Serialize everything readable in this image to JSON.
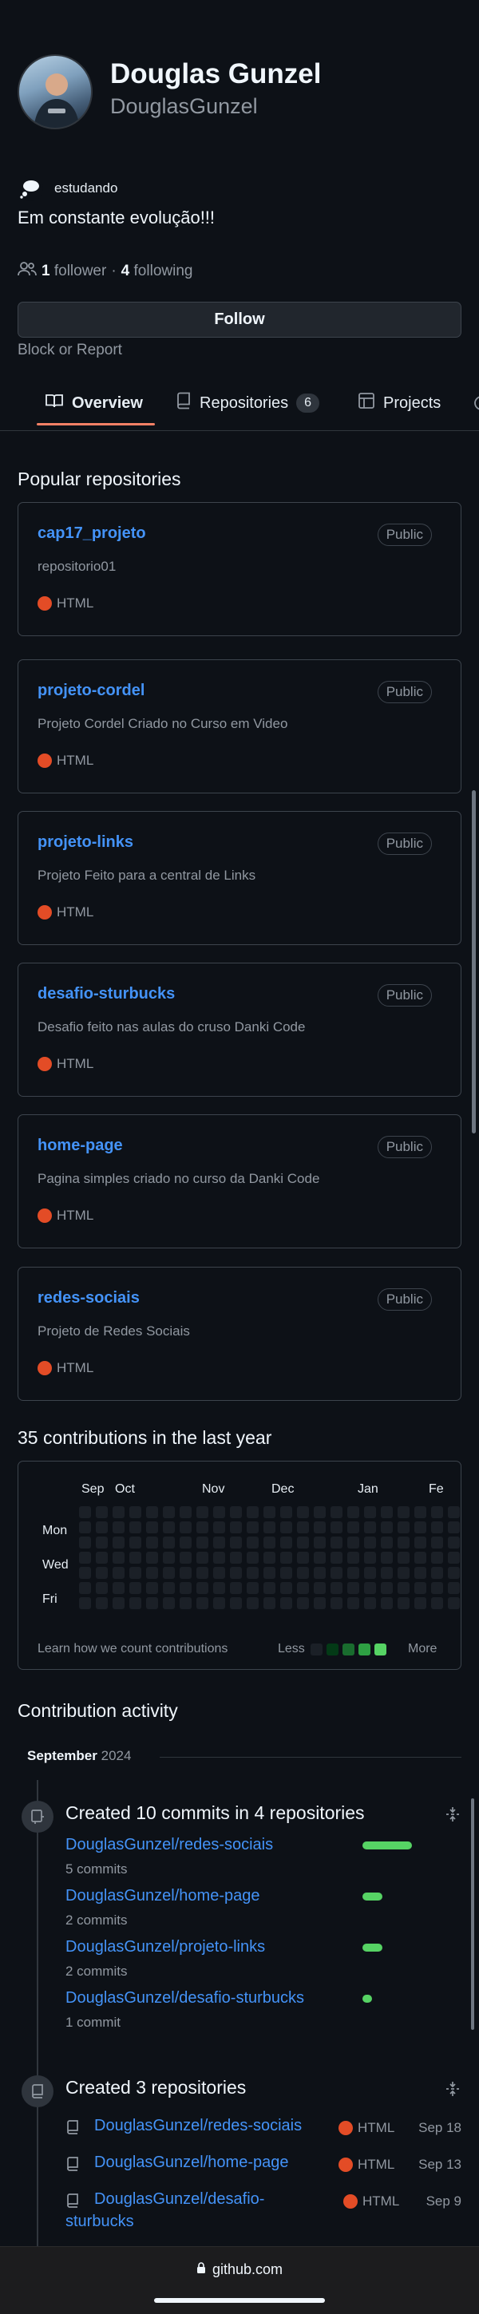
{
  "profile": {
    "name": "Douglas Gunzel",
    "login": "DouglasGunzel",
    "status_text": "estudando",
    "bio": "Em constante evolução!!!",
    "followers_count": "1",
    "followers_label": "follower",
    "separator": "·",
    "following_count": "4",
    "following_label": "following",
    "follow_button": "Follow",
    "block_link": "Block or Report"
  },
  "tabs": [
    {
      "label": "Overview",
      "icon": "book-icon",
      "active": true
    },
    {
      "label": "Repositories",
      "icon": "repo-icon",
      "count": "6"
    },
    {
      "label": "Projects",
      "icon": "table-icon"
    }
  ],
  "popular": {
    "title": "Popular repositories",
    "repos": [
      {
        "name": "cap17_projeto",
        "visibility": "Public",
        "description": "repositorio01",
        "language": "HTML"
      },
      {
        "name": "projeto-cordel",
        "visibility": "Public",
        "description": "Projeto Cordel Criado no Curso em Video",
        "language": "HTML"
      },
      {
        "name": "projeto-links",
        "visibility": "Public",
        "description": "Projeto Feito para a central de Links",
        "language": "HTML"
      },
      {
        "name": "desafio-sturbucks",
        "visibility": "Public",
        "description": "Desafio feito nas aulas do cruso Danki Code",
        "language": "HTML"
      },
      {
        "name": "home-page",
        "visibility": "Public",
        "description": "Pagina simples criado no curso da Danki Code",
        "language": "HTML"
      },
      {
        "name": "redes-sociais",
        "visibility": "Public",
        "description": "Projeto de Redes Sociais",
        "language": "HTML"
      }
    ]
  },
  "contributions": {
    "title": "35 contributions in the last year",
    "months": [
      "Sep",
      "Oct",
      "Nov",
      "Dec",
      "Jan",
      "Fe"
    ],
    "days": [
      "Mon",
      "Wed",
      "Fri"
    ],
    "learn_link": "Learn how we count contributions",
    "less": "Less",
    "more": "More",
    "colors": [
      "#1b2027",
      "#033a16",
      "#196c2e",
      "#2ea043",
      "#56d364"
    ]
  },
  "activity": {
    "title": "Contribution activity",
    "month": "September",
    "year": "2024",
    "commits_title": "Created 10 commits in 4 repositories",
    "commits": [
      {
        "repo": "DouglasGunzel/redes-sociais",
        "count_label": "5 commits",
        "value": 5
      },
      {
        "repo": "DouglasGunzel/home-page",
        "count_label": "2 commits",
        "value": 2
      },
      {
        "repo": "DouglasGunzel/projeto-links",
        "count_label": "2 commits",
        "value": 2
      },
      {
        "repo": "DouglasGunzel/desafio-sturbucks",
        "count_label": "1 commit",
        "value": 1
      }
    ],
    "repos_title": "Created 3 repositories",
    "created": [
      {
        "repo": "DouglasGunzel/redes-sociais",
        "language": "HTML",
        "date": "Sep 18"
      },
      {
        "repo": "DouglasGunzel/home-page",
        "language": "HTML",
        "date": "Sep 13"
      },
      {
        "repo": "DouglasGunzel/desafio-sturbucks",
        "repo_line2": "sturbucks",
        "repo_line1": "DouglasGunzel/desafio-",
        "language": "HTML",
        "date": "Sep 9"
      }
    ]
  },
  "browser": {
    "url": "github.com"
  }
}
